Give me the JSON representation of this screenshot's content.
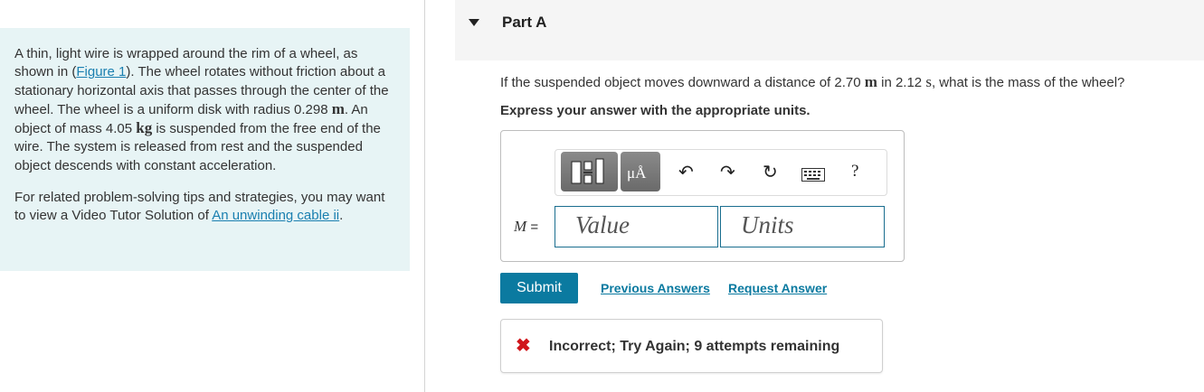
{
  "problem": {
    "p1": {
      "t1": "A thin, light wire is wrapped around the rim of a wheel, as shown in (",
      "figure_link": "Figure 1",
      "t2": "). The wheel rotates without friction about a stationary horizontal axis that passes through the center of the wheel. The wheel is a uniform disk with radius 0.298 ",
      "u1": "m",
      "t3": ". An object of mass 4.05 ",
      "u2": "kg",
      "t4": " is suspended from the free end of the wire. The system is released from rest and the suspended object descends with constant acceleration."
    },
    "p2": {
      "text": "For related problem-solving tips and strategies, you may want to view a Video Tutor Solution of ",
      "link": "An unwinding cable ii",
      "end": "."
    }
  },
  "part": {
    "title": "Part A"
  },
  "question": {
    "t1": "If the suspended object moves downward a distance of 2.70 ",
    "u1": "m",
    "t2": " in 2.12 ",
    "u2": "s",
    "t3": ", what is the mass of the wheel?"
  },
  "instructions": "Express your answer with the appropriate units.",
  "toolbar": {
    "units_symbol": "μÅ",
    "undo_icon": "↶",
    "redo_icon": "↷",
    "reset_icon": "↻",
    "help": "?"
  },
  "answer": {
    "variable": "M",
    "equals": " =",
    "value_placeholder": "Value",
    "units_placeholder": "Units"
  },
  "actions": {
    "submit": "Submit",
    "previous_answers": "Previous Answers",
    "request_answer": "Request Answer"
  },
  "feedback": {
    "icon": "✖",
    "text": "Incorrect; Try Again; 9 attempts remaining"
  },
  "colors": {
    "panel_bg": "#e7f4f5",
    "accent": "#0b7aa0",
    "error": "#d0161b"
  }
}
